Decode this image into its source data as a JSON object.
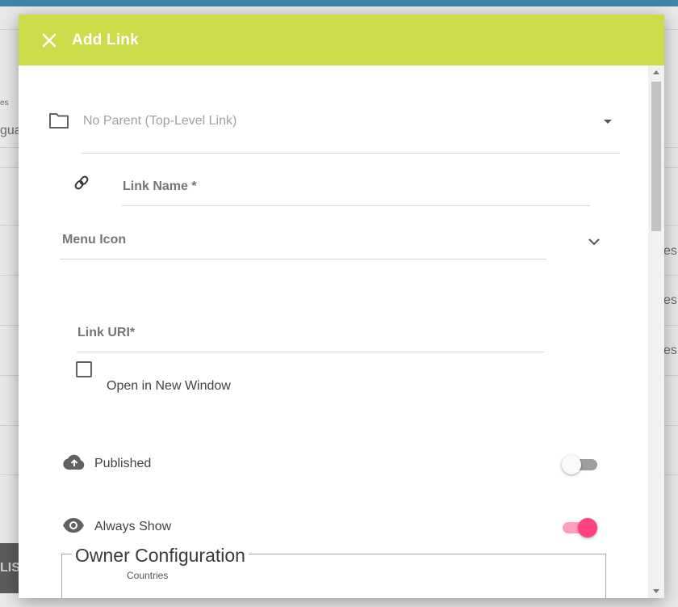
{
  "background": {
    "left_snippet_1": "es",
    "left_snippet_2": "gua",
    "right_snippet": "es",
    "bottom_snippet": "LIS"
  },
  "dialog": {
    "title": "Add Link",
    "parent_select": {
      "placeholder": "No Parent (Top-Level Link)"
    },
    "link_name": {
      "label": "Link Name *"
    },
    "menu_icon": {
      "label": "Menu Icon"
    },
    "link_uri": {
      "label": "Link URI*"
    },
    "open_new_window": {
      "label": "Open in New Window",
      "checked": false
    },
    "published": {
      "label": "Published",
      "on": false
    },
    "always_show": {
      "label": "Always Show",
      "on": true
    },
    "owner_config": {
      "legend": "Owner Configuration",
      "countries_label": "Countries"
    }
  },
  "colors": {
    "header": "#cddc4b",
    "accent": "#ff4081",
    "accent_track": "#ff9ec0"
  }
}
